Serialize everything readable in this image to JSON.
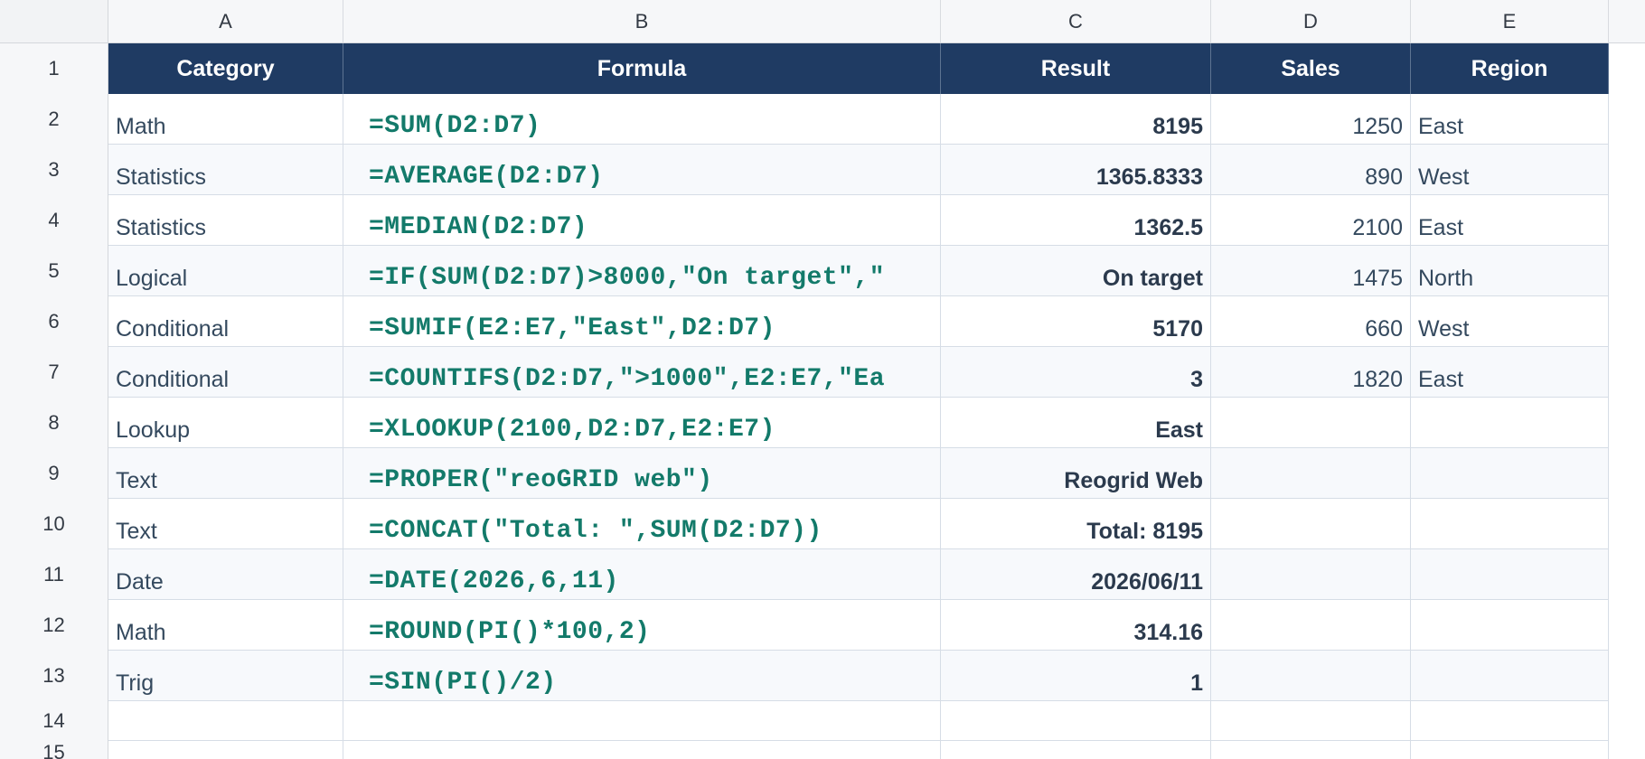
{
  "columns": [
    "A",
    "B",
    "C",
    "D",
    "E"
  ],
  "rows": [
    "1",
    "2",
    "3",
    "4",
    "5",
    "6",
    "7",
    "8",
    "9",
    "10",
    "11",
    "12",
    "13",
    "14",
    "15"
  ],
  "header": {
    "category": "Category",
    "formula": "Formula",
    "result": "Result",
    "sales": "Sales",
    "region": "Region"
  },
  "data": [
    {
      "category": "Math",
      "formula": "=SUM(D2:D7)",
      "result": "8195",
      "sales": "1250",
      "region": "East"
    },
    {
      "category": "Statistics",
      "formula": "=AVERAGE(D2:D7)",
      "result": "1365.8333",
      "sales": "890",
      "region": "West"
    },
    {
      "category": "Statistics",
      "formula": "=MEDIAN(D2:D7)",
      "result": "1362.5",
      "sales": "2100",
      "region": "East"
    },
    {
      "category": "Logical",
      "formula": "=IF(SUM(D2:D7)>8000,\"On target\",\"",
      "result": "On target",
      "sales": "1475",
      "region": "North"
    },
    {
      "category": "Conditional",
      "formula": "=SUMIF(E2:E7,\"East\",D2:D7)",
      "result": "5170",
      "sales": "660",
      "region": "West"
    },
    {
      "category": "Conditional",
      "formula": "=COUNTIFS(D2:D7,\">1000\",E2:E7,\"Ea",
      "result": "3",
      "sales": "1820",
      "region": "East"
    },
    {
      "category": "Lookup",
      "formula": "=XLOOKUP(2100,D2:D7,E2:E7)",
      "result": "East",
      "sales": "",
      "region": ""
    },
    {
      "category": "Text",
      "formula": "=PROPER(\"reoGRID web\")",
      "result": "Reogrid Web",
      "sales": "",
      "region": ""
    },
    {
      "category": "Text",
      "formula": "=CONCAT(\"Total: \",SUM(D2:D7))",
      "result": "Total: 8195",
      "sales": "",
      "region": ""
    },
    {
      "category": "Date",
      "formula": "=DATE(2026,6,11)",
      "result": "2026/06/11",
      "sales": "",
      "region": ""
    },
    {
      "category": "Math",
      "formula": "=ROUND(PI()*100,2)",
      "result": "314.16",
      "sales": "",
      "region": ""
    },
    {
      "category": "Trig",
      "formula": "=SIN(PI()/2)",
      "result": "1",
      "sales": "",
      "region": ""
    }
  ],
  "colors": {
    "header_bg": "#1f3b63",
    "formula_text": "#137a6a",
    "cell_text": "#34495e"
  }
}
